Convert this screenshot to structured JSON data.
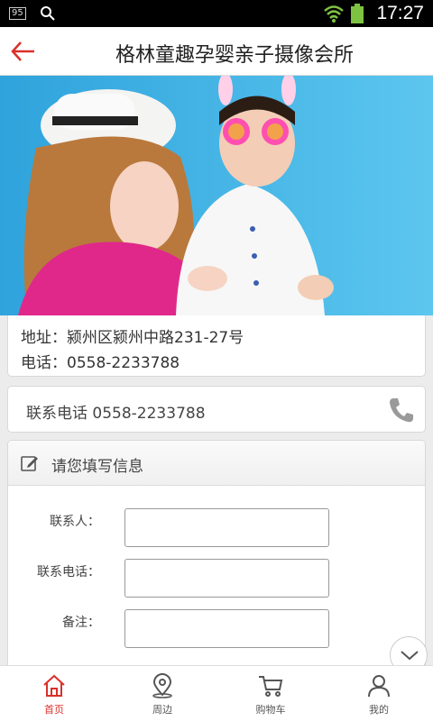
{
  "status_bar": {
    "badge": "95",
    "time": "17:27"
  },
  "header": {
    "title": "格林童趣孕婴亲子摄像会所"
  },
  "info": {
    "address": "地址：颍州区颍州中路231-27号",
    "phone": "电话：0558-2233788"
  },
  "contact": {
    "label": "联系电话 0558-2233788"
  },
  "form": {
    "title": "请您填写信息",
    "fields": [
      {
        "label": "联系人：",
        "value": ""
      },
      {
        "label": "联系电话：",
        "value": ""
      },
      {
        "label": "备注：",
        "value": ""
      }
    ]
  },
  "tabs": [
    {
      "label": "首页",
      "icon": "home-icon",
      "active": true
    },
    {
      "label": "周边",
      "icon": "location-icon",
      "active": false
    },
    {
      "label": "购物车",
      "icon": "cart-icon",
      "active": false
    },
    {
      "label": "我的",
      "icon": "user-icon",
      "active": false
    }
  ],
  "colors": {
    "accent": "#d9302a",
    "banner_bg": "#3fb6ea"
  }
}
